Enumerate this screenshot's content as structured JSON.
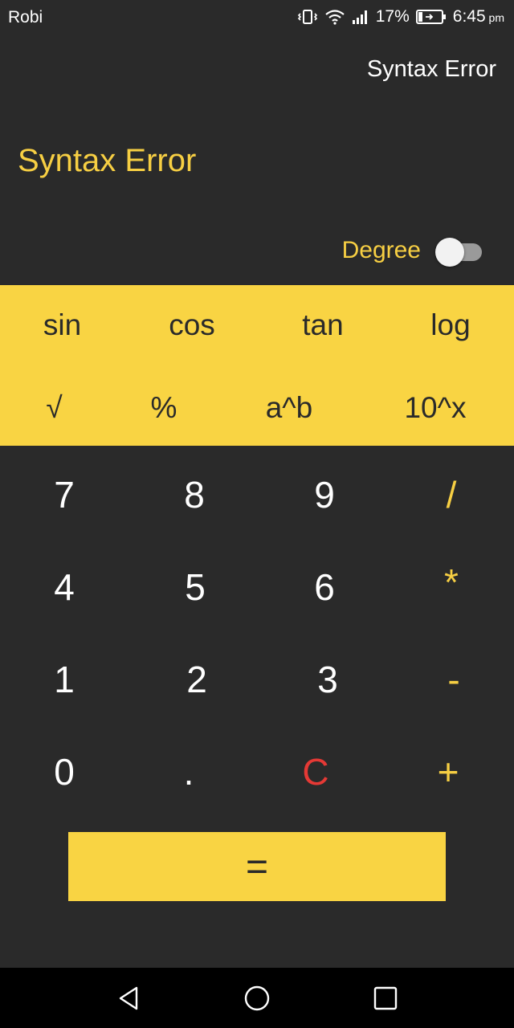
{
  "status_bar": {
    "carrier": "Robi",
    "battery": "17%",
    "time": "6:45",
    "time_suffix": "pm",
    "icons": [
      "vibrate-icon",
      "wifi-icon",
      "signal-icon",
      "battery-icon"
    ]
  },
  "display": {
    "expression": "Syntax Error",
    "result": "Syntax Error",
    "degree_label": "Degree",
    "degree_toggle_on": false
  },
  "scientific": {
    "row1": [
      "sin",
      "cos",
      "tan",
      "log"
    ],
    "row2": [
      "√",
      "%",
      "a^b",
      "10^x"
    ]
  },
  "keypad": {
    "row1": [
      "7",
      "8",
      "9",
      "/"
    ],
    "row2": [
      "4",
      "5",
      "6",
      "*"
    ],
    "row3": [
      "1",
      "2",
      "3",
      "-"
    ],
    "row4": [
      "0",
      ".",
      "C",
      "+"
    ],
    "equals": "="
  },
  "navbar": {
    "icons": [
      "back-icon",
      "home-icon",
      "recents-icon"
    ]
  },
  "colors": {
    "background": "#2a2a2a",
    "accent": "#f9d443",
    "clear": "#e53935"
  }
}
